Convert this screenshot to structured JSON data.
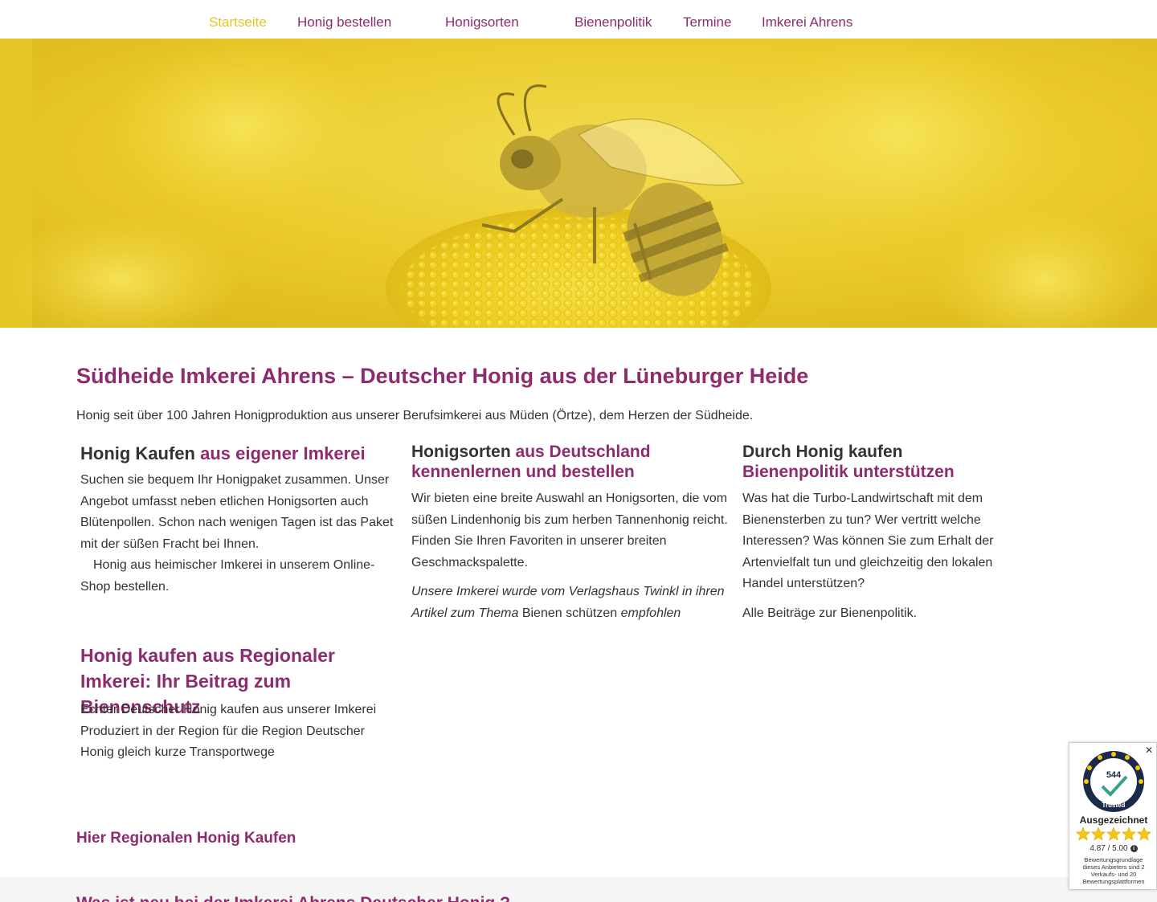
{
  "colors": {
    "primary": "#8e2a6e",
    "active_nav": "#e8c426",
    "hero_yellow": "#e6c21e",
    "text": "#333333"
  },
  "nav": {
    "items": [
      {
        "label": "Startseite",
        "active": true
      },
      {
        "label": "Honig bestellen"
      },
      {
        "label": "Honigsorten"
      },
      {
        "label": "Bienenpolitik"
      },
      {
        "label": "Termine"
      },
      {
        "label": "Imkerei Ahrens"
      }
    ]
  },
  "hero": {
    "image": "bee-on-yellow-flower"
  },
  "main": {
    "title": "Südheide Imkerei Ahrens – Deutscher Honig aus der Lüneburger Heide",
    "intro": "Honig seit über 100 Jahren Honigproduktion aus unserer Berufsimkerei aus Müden (Örtze), dem Herzen der Südheide.",
    "columns": [
      {
        "heading_plain": "Honig Kaufen",
        "heading_accent": "aus eigener Imkerei",
        "p1": "Suchen sie bequem Ihr Honigpaket zusammen. Unser Angebot umfasst neben etlichen Honigsorten auch Blütenpollen. Schon nach wenigen Tagen ist das Paket mit der süßen Fracht bei Ihnen.",
        "p2": "Honig aus heimischer Imkerei in unserem Online-Shop bestellen."
      },
      {
        "heading_plain": "Honigsorten",
        "heading_accent": "aus Deutschland kennenlernen und bestellen",
        "p1": "Wir bieten eine breite Auswahl an Honigsorten, die vom süßen Lindenhonig bis zum herben Tannenhonig reicht. Finden Sie Ihren Favoriten in unserer breiten Geschmackspalette.",
        "p2_italic": "Unsere Imkerei wurde vom Verlagshaus Twinkl in ihren Artikel zum Thema",
        "p2_link": "Bienen schützen",
        "p2_italic_end": "empfohlen"
      },
      {
        "heading_plain": "Durch Honig kaufen",
        "heading_accent": "Bienenpolitik unterstützen",
        "p1": "Was hat die Turbo-Landwirtschaft mit dem Bienensterben zu tun? Wer vertritt welche Interessen? Was können Sie zum Erhalt der Artenvielfalt tun und gleichzeitig den lokalen Handel unterstützen?",
        "p2": "Alle Beiträge zur Bienenpolitik."
      }
    ],
    "regional": {
      "title": "Honig kaufen aus Regionaler Imkerei: Ihr Beitrag zum Bienenschutz",
      "text": "Echter Deutscher Honig kaufen aus unserer Imkerei Produziert in der Region für die Region Deutscher Honig gleich kurze Transportwege"
    },
    "cta": "Hier Regionalen Honig Kaufen",
    "news_title": "Was ist neu bei der Imkerei Ahrens Deutscher Honig ?"
  },
  "trust_badge": {
    "count": "544",
    "brand": "Trusted",
    "label": "Ausgezeichnet",
    "rating": 4.87,
    "score": "4.87 / 5.00",
    "note": "Bewertungsgrundlage dieses Anbieters sind 2 Verkaufs- und 20 Bewertungsplattformen",
    "close": "✕",
    "stars_icon": "star-icon",
    "info_icon": "i"
  }
}
